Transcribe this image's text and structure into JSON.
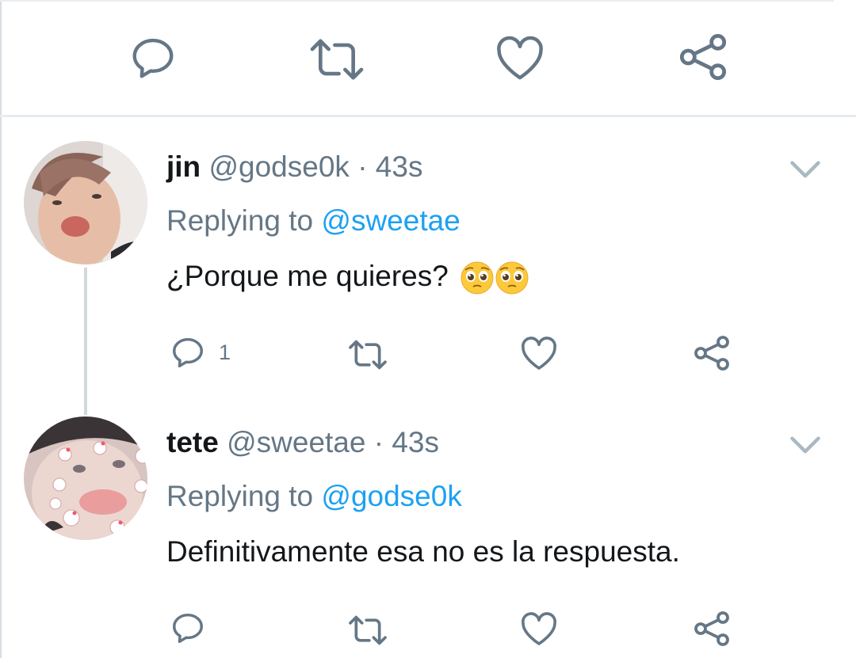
{
  "top_actions": {
    "reply_icon": "reply-icon",
    "retweet_icon": "retweet-icon",
    "like_icon": "heart-icon",
    "share_icon": "share-icon"
  },
  "tweets": [
    {
      "display_name": "jin",
      "handle": "@godse0k",
      "separator": "·",
      "time": "43s",
      "replying_prefix": "Replying to",
      "replying_to": "@sweetae",
      "text": "¿Porque me quieres?",
      "emojis": [
        "pleading-face",
        "pleading-face"
      ],
      "reply_count": "1"
    },
    {
      "display_name": "tete",
      "handle": "@sweetae",
      "separator": "·",
      "time": "43s",
      "replying_prefix": "Replying to",
      "replying_to": "@godse0k",
      "text": "Definitivamente esa no es la respuesta.",
      "reply_count": ""
    }
  ],
  "colors": {
    "icon_gray": "#657786",
    "mention_blue": "#1da1f2",
    "text_dark": "#14171a",
    "divider": "#e6ecf0"
  }
}
